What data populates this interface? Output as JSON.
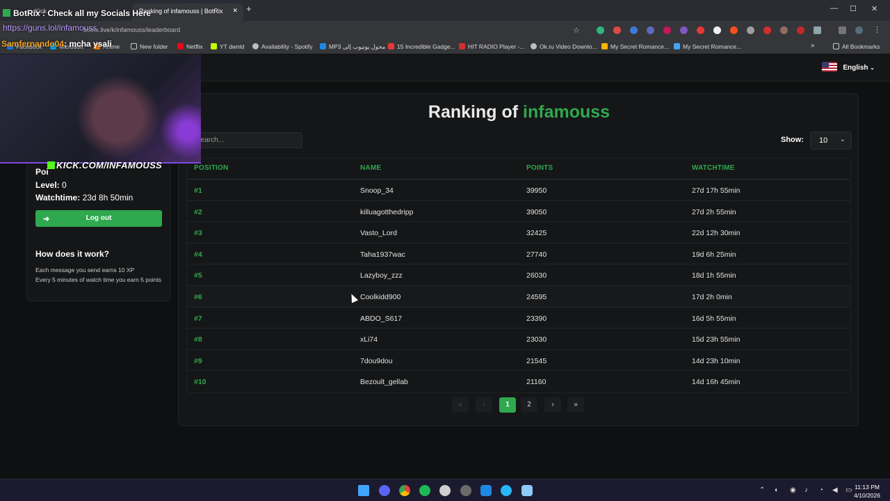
{
  "browser": {
    "tabs": [
      {
        "label": "Kick"
      },
      {
        "label": "Ranking of infamouss | BotRix"
      }
    ],
    "url": "botrix.live/k/infamouss/leaderboard",
    "bookmarks": [
      "Facebook",
      "Microsoft",
      "Anime",
      "New folder",
      "Netflix",
      "YT  dwnld",
      "Availability - Spotify",
      "MP3 محول يوتيوب إلى",
      "15 Incredible Gadge...",
      "HIT RADIO Player -...",
      "Ok.ru Video Downlo...",
      "My Secret Romance...",
      "My Secret Romance..."
    ],
    "all_bookmarks": "All Bookmarks"
  },
  "nav": {
    "language": "English"
  },
  "sidebar": {
    "points_label": "Poi",
    "level_label": "Level:",
    "level_value": "0",
    "watchtime_label": "Watchtime:",
    "watchtime_value": "23d 8h 50min",
    "logout_label": "Log out",
    "how_title": "How does it work?",
    "how_lines": [
      "Each message you send earns 10 XP",
      "Every 5 minutes of watch time you earn 5 points"
    ]
  },
  "leaderboard": {
    "title_prefix": "Ranking of",
    "title_name": "infamouss",
    "search_placeholder": "Search...",
    "show_label": "Show:",
    "show_value": "10",
    "headers": [
      "POSITION",
      "NAME",
      "POINTS",
      "WATCHTIME"
    ],
    "rows": [
      {
        "pos": "#1",
        "name": "Snoop_34",
        "points": "39950",
        "watchtime": "27d 17h 55min"
      },
      {
        "pos": "#2",
        "name": "killuagotthedripp",
        "points": "39050",
        "watchtime": "27d 2h 55min"
      },
      {
        "pos": "#3",
        "name": "Vasto_Lord",
        "points": "32425",
        "watchtime": "22d 12h 30min"
      },
      {
        "pos": "#4",
        "name": "Taha1937wac",
        "points": "27740",
        "watchtime": "19d 6h 25min"
      },
      {
        "pos": "#5",
        "name": "Lazyboy_zzz",
        "points": "26030",
        "watchtime": "18d 1h 55min"
      },
      {
        "pos": "#6",
        "name": "Coolkidd900",
        "points": "24595",
        "watchtime": "17d 2h 0min"
      },
      {
        "pos": "#7",
        "name": "ABDO_S617",
        "points": "23390",
        "watchtime": "16d 5h 55min"
      },
      {
        "pos": "#8",
        "name": "xLi74",
        "points": "23030",
        "watchtime": "15d 23h 55min"
      },
      {
        "pos": "#9",
        "name": "7dou9dou",
        "points": "21545",
        "watchtime": "14d 23h 10min"
      },
      {
        "pos": "#10",
        "name": "Bezoult_gellab",
        "points": "21160",
        "watchtime": "14d 16h 45min"
      }
    ],
    "pages": [
      "1",
      "2"
    ],
    "current_page": "1"
  },
  "overlay": {
    "chat_top": "BotRix : Check all my Socials Here",
    "chat_link": "https://guns.lol/infamouss",
    "chat_user": "Samfernando04",
    "chat_msg": ": mcha ysali",
    "cam_name": "KICK.COM/INFAMOUSS"
  },
  "taskbar": {
    "time": "11:13 PM",
    "date": "4/10/2026"
  }
}
